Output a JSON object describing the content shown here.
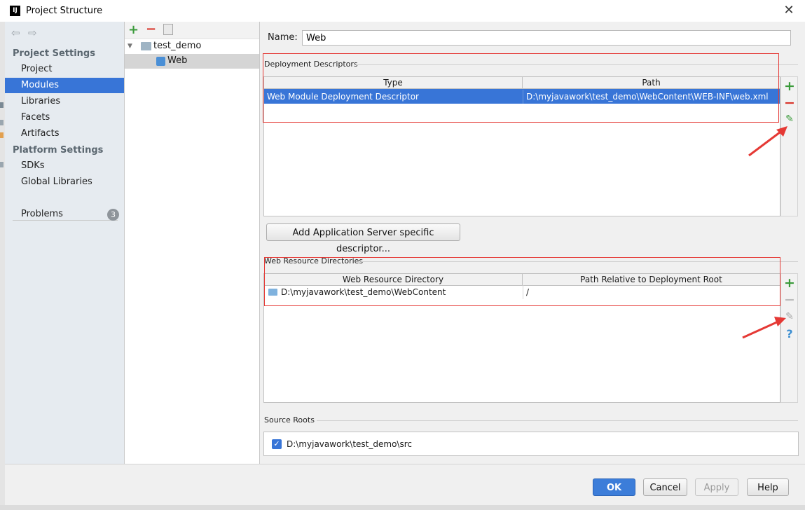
{
  "window": {
    "title": "Project Structure",
    "icon_text": "IJ"
  },
  "sidebar": {
    "project_settings_title": "Project Settings",
    "project_items": [
      "Project",
      "Modules",
      "Libraries",
      "Facets",
      "Artifacts"
    ],
    "selected_item": "Modules",
    "platform_settings_title": "Platform Settings",
    "platform_items": [
      "SDKs",
      "Global Libraries"
    ],
    "problems_label": "Problems",
    "problems_count": "3"
  },
  "tree": {
    "root": "test_demo",
    "child": "Web"
  },
  "facet": {
    "name_label": "Name:",
    "name_value": "Web",
    "deployment": {
      "title": "Deployment Descriptors",
      "columns": [
        "Type",
        "Path"
      ],
      "rows": [
        {
          "type": "Web Module Deployment Descriptor",
          "path": "D:\\myjavawork\\test_demo\\WebContent\\WEB-INF\\web.xml"
        }
      ],
      "add_server_button": "Add Application Server specific descriptor..."
    },
    "web_resources": {
      "title": "Web Resource Directories",
      "columns": [
        "Web Resource Directory",
        "Path Relative to Deployment Root"
      ],
      "rows": [
        {
          "directory": "D:\\myjavawork\\test_demo\\WebContent",
          "relative": "/"
        }
      ]
    },
    "source_roots": {
      "title": "Source Roots",
      "items": [
        {
          "path": "D:\\myjavawork\\test_demo\\src",
          "checked": true
        }
      ]
    }
  },
  "buttons": {
    "ok": "OK",
    "cancel": "Cancel",
    "apply": "Apply",
    "help": "Help"
  },
  "colors": {
    "selection": "#3875d7",
    "annotation": "#e53935",
    "add": "#3a9a3a",
    "remove": "#d9362c"
  }
}
